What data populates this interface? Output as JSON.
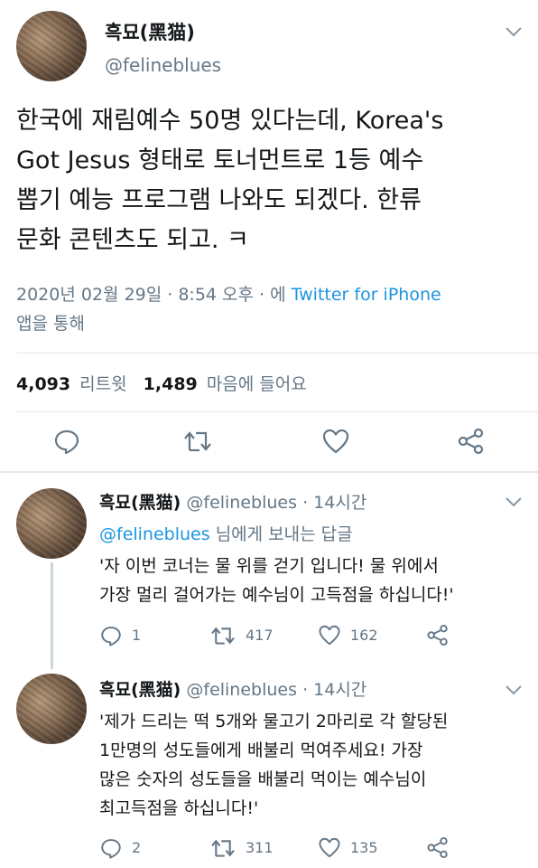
{
  "main_tweet": {
    "display_name": "흑묘(黑猫)",
    "handle": "@felineblues",
    "text_lines": [
      "한국에 재림예수 50명 있다는데, Korea's",
      "Got Jesus 형태로 토너먼트로 1등 예수",
      "뽑기 예능 프로그램 나와도 되겠다. 한류",
      "문화 콘텐츠도 되고. ㅋ"
    ],
    "timestamp": "2020년 02월 29일 · 8:54 오후 · 에",
    "source": "Twitter for iPhone",
    "via": "앱을 통해",
    "retweet_count": "4,093",
    "retweet_label": "리트윗",
    "like_count": "1,489",
    "like_label": "마음에 들어요"
  },
  "replies": [
    {
      "display_name": "흑묘(黑猫)",
      "handle": "@felineblues",
      "time": "· 14시간",
      "reply_to_handle": "@felineblues",
      "reply_to_suffix": "님에게 보내는 답글",
      "text_lines": [
        "'자 이번 코너는 물 위를 걷기 입니다! 물 위에서",
        "가장 멀리 걸어가는 예수님이 고득점을 하십니다!'"
      ],
      "reply_count": "1",
      "retweet_count": "417",
      "like_count": "162"
    },
    {
      "display_name": "흑묘(黑猫)",
      "handle": "@felineblues",
      "time": "· 14시간",
      "text_lines": [
        "'제가 드리는 떡 5개와 물고기 2마리로 각 할당된",
        "1만명의 성도들에게 배불리 먹여주세요! 가장",
        "많은 숫자의 성도들을 배불리 먹이는 예수님이",
        "최고득점을 하십니다!'"
      ],
      "reply_count": "2",
      "retweet_count": "311",
      "like_count": "135"
    }
  ],
  "icons": {
    "reply": "reply-icon",
    "retweet": "retweet-icon",
    "like": "heart-icon",
    "share": "share-icon",
    "chevron": "chevron-down-icon"
  },
  "colors": {
    "link": "#1b95e0",
    "secondary": "#657786",
    "text": "#14171a"
  }
}
